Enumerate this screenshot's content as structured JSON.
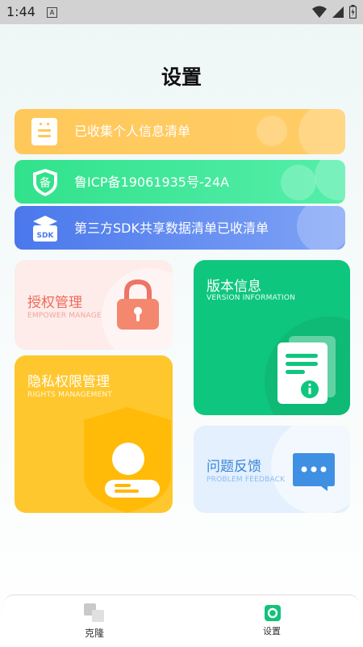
{
  "status_bar": {
    "time": "1:44",
    "notification_letter": "A"
  },
  "page": {
    "title": "设置"
  },
  "banners": [
    {
      "label": "已收集个人信息清单",
      "icon": "list-document-icon"
    },
    {
      "label": "鲁ICP备19061935号-24A",
      "icon": "icp-shield-icon"
    },
    {
      "label": "第三方SDK共享数据清单已收清单",
      "icon": "sdk-package-icon"
    }
  ],
  "cards": {
    "empower": {
      "title": "授权管理",
      "subtitle": "EMPOWER MANAGE"
    },
    "rights": {
      "title": "隐私权限管理",
      "subtitle": "RIGHTS MANAGEMENT"
    },
    "version": {
      "title": "版本信息",
      "subtitle": "VERSION INFORMATION"
    },
    "feedback": {
      "title": "问题反馈",
      "subtitle": "PROBLEM FEEDBACK"
    }
  },
  "bottom_nav": [
    {
      "label": "克隆",
      "active": false
    },
    {
      "label": "设置",
      "active": true
    }
  ],
  "colors": {
    "banner_yellow": "#ffc85a",
    "banner_green": "#31e28b",
    "banner_blue": "#4a78ec",
    "empower_red": "#ef6a5a",
    "rights_yellow": "#ffc72e",
    "version_green": "#0fc67e",
    "feedback_blue": "#3a86d8",
    "nav_active": "#12c27a"
  }
}
